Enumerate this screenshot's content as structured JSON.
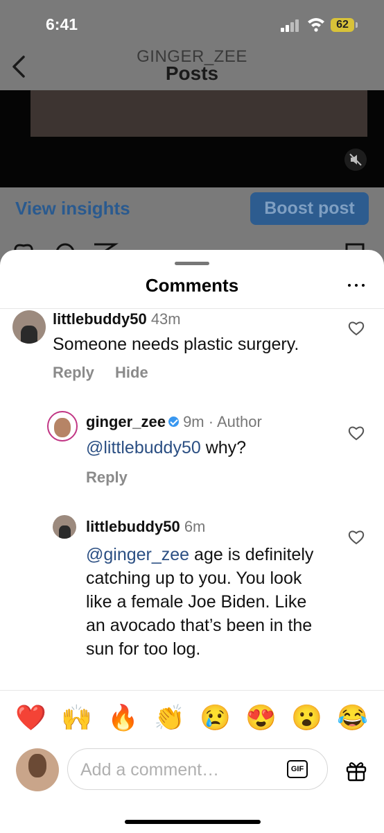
{
  "status_bar": {
    "time": "6:41",
    "battery": "62"
  },
  "header": {
    "username": "GINGER_ZEE",
    "title": "Posts"
  },
  "post_actions": {
    "insights_label": "View insights",
    "boost_label": "Boost post"
  },
  "sheet": {
    "title": "Comments",
    "comments": [
      {
        "user": "littlebuddy50",
        "time": "43m",
        "author_tag": "",
        "mention": "",
        "text": "Someone needs plastic surgery.",
        "reply": "Reply",
        "hide": "Hide"
      },
      {
        "user": "ginger_zee",
        "time": "9m",
        "author_tag": "· Author",
        "mention": "@littlebuddy50",
        "text": " why?",
        "reply": "Reply",
        "hide": ""
      },
      {
        "user": "littlebuddy50",
        "time": "6m",
        "author_tag": "",
        "mention": "@ginger_zee",
        "text": "age is definitely catching up to you. You look like a female Joe Biden. Like an avocado that’s been in the sun for too log.",
        "reply": "",
        "hide": ""
      }
    ]
  },
  "emojis": [
    "❤️",
    "🙌",
    "🔥",
    "👏",
    "😢",
    "😍",
    "😮",
    "😂"
  ],
  "composer": {
    "placeholder": "Add a comment…",
    "gif_label": "GIF"
  },
  "colors": {
    "accent": "#3897f0",
    "mention": "#2b4f83",
    "boost": "#2d5c8f"
  }
}
